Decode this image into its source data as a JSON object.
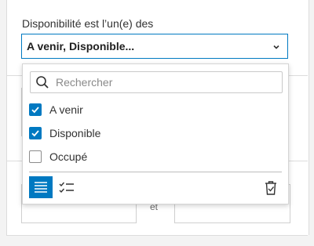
{
  "filter": {
    "label": "Disponibilité est l’un(e) des",
    "selected_value": "A venir, Disponible...",
    "chevron_icon": "chevron-down-icon"
  },
  "dropdown": {
    "search_placeholder": "Rechercher",
    "options": [
      {
        "label": "A venir",
        "checked": true
      },
      {
        "label": "Disponible",
        "checked": true
      },
      {
        "label": "Occupé",
        "checked": false
      }
    ],
    "toolbar": {
      "list_view_icon": "list-icon",
      "select_all_icon": "checklist-icon",
      "clear_icon": "trash-icon"
    }
  },
  "background": {
    "connector_text": "et"
  },
  "colors": {
    "accent": "#0079c1",
    "text": "#323232"
  }
}
